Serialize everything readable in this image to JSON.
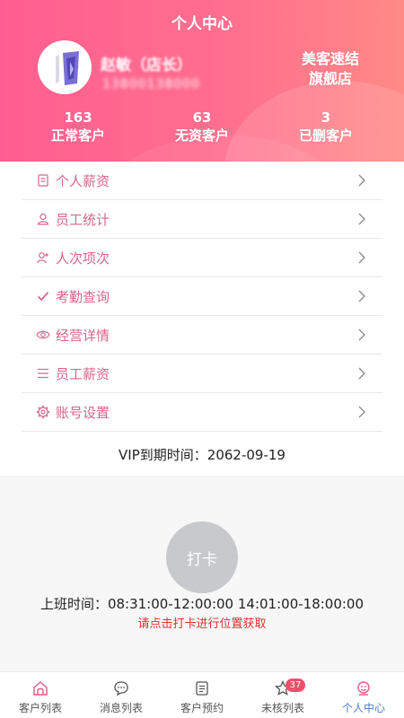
{
  "header": {
    "title": "个人中心",
    "user_name": "赵敏（店长）",
    "user_phone": "13800138000",
    "store_name_line1": "美客速结",
    "store_name_line2": "旗舰店",
    "stats": [
      {
        "value": "163",
        "label": "正常客户"
      },
      {
        "value": "63",
        "label": "无资客户"
      },
      {
        "value": "3",
        "label": "已删客户"
      }
    ]
  },
  "menu": [
    {
      "label": "个人薪资",
      "icon": "document-icon"
    },
    {
      "label": "员工统计",
      "icon": "person-icon"
    },
    {
      "label": "人次项次",
      "icon": "person-add-icon"
    },
    {
      "label": "考勤查询",
      "icon": "check-icon"
    },
    {
      "label": "经营详情",
      "icon": "eye-icon"
    },
    {
      "label": "员工薪资",
      "icon": "list-icon"
    },
    {
      "label": "账号设置",
      "icon": "gear-icon"
    }
  ],
  "vip": {
    "text": "VIP到期时间：2062-09-19"
  },
  "punch": {
    "button_label": "打卡",
    "work_time": "上班时间：08:31:00-12:00:00 14:01:00-18:00:00",
    "hint": "请点击打卡进行位置获取"
  },
  "tabbar": {
    "tabs": [
      {
        "label": "客户列表",
        "icon": "home-icon"
      },
      {
        "label": "消息列表",
        "icon": "message-icon"
      },
      {
        "label": "客户预约",
        "icon": "calendar-icon"
      },
      {
        "label": "未核列表",
        "icon": "star-icon",
        "badge": "37"
      },
      {
        "label": "个人中心",
        "icon": "profile-icon",
        "active": true
      }
    ]
  },
  "colors": {
    "header_start": "#ff5f90",
    "header_end": "#ff8a86",
    "menu_text": "#d7648c",
    "hint_red": "#e0302c",
    "tab_active": "#4a7fd6",
    "badge": "#ee4f6b"
  }
}
